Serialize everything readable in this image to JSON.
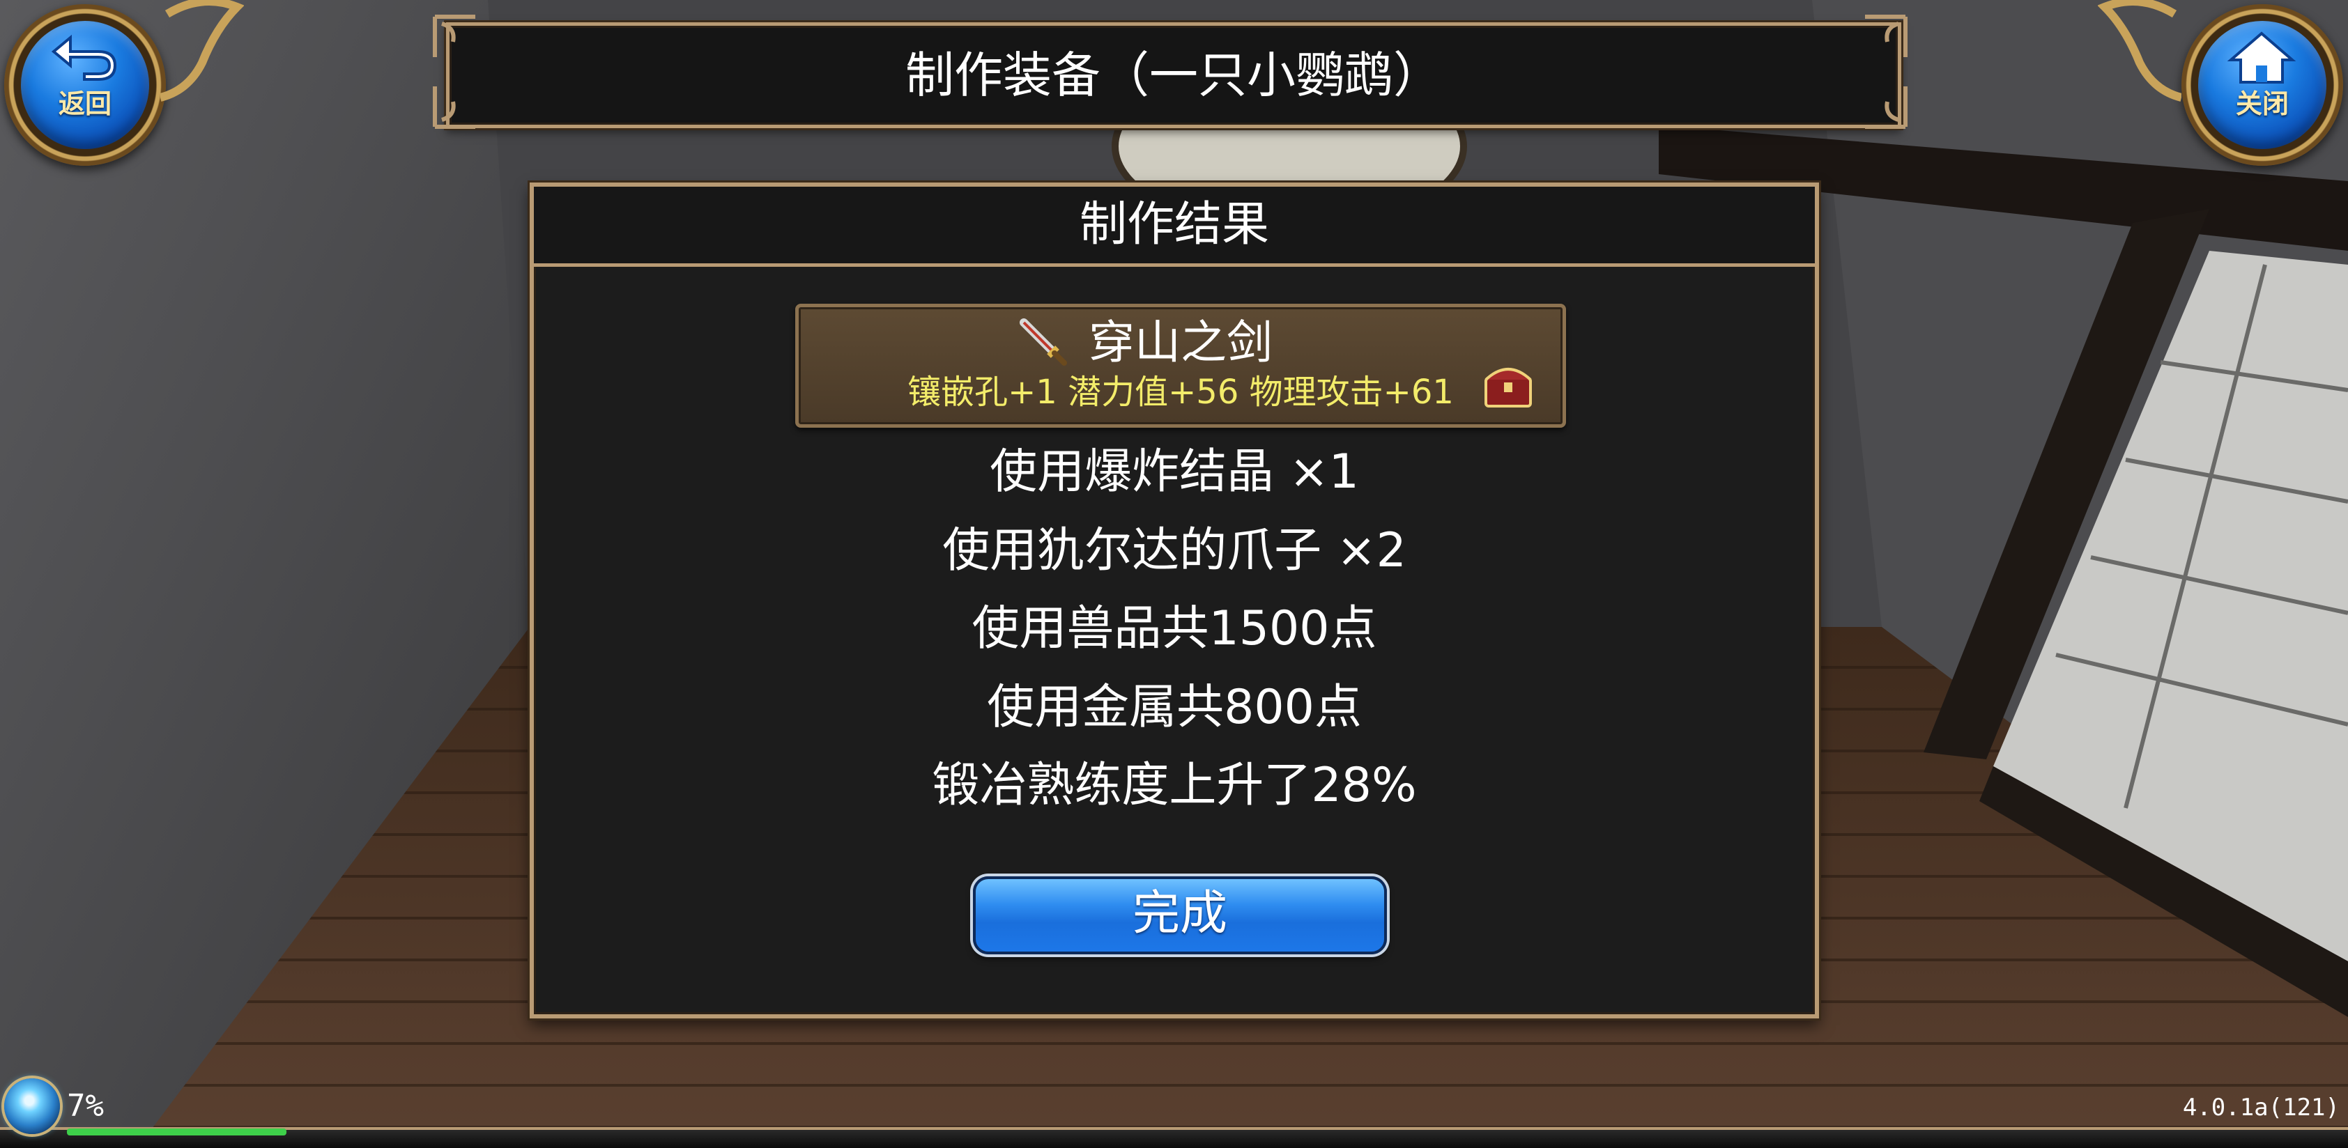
{
  "header": {
    "title": "制作装备（一只小鹦鹉）",
    "back_label": "返回",
    "close_label": "关闭"
  },
  "dialog": {
    "title": "制作结果",
    "item": {
      "name": "穿山之剑",
      "stats": "镶嵌孔+1 潜力值+56 物理攻击+61",
      "icon": "sword-icon",
      "bonus_icon": "treasure-chest-icon"
    },
    "results": [
      "使用爆炸结晶 ×1",
      "使用犰尔达的爪子 ×2",
      "使用兽品共1500点",
      "使用金属共800点",
      "锻冶熟练度上升了28%"
    ],
    "done_label": "完成"
  },
  "status": {
    "percent": "7%",
    "progress": 0.07,
    "version": "4.0.1a(121)"
  },
  "colors": {
    "frame": "#b99b74",
    "stats_text": "#f3ec6a",
    "button_blue": "#1a6fdc"
  }
}
